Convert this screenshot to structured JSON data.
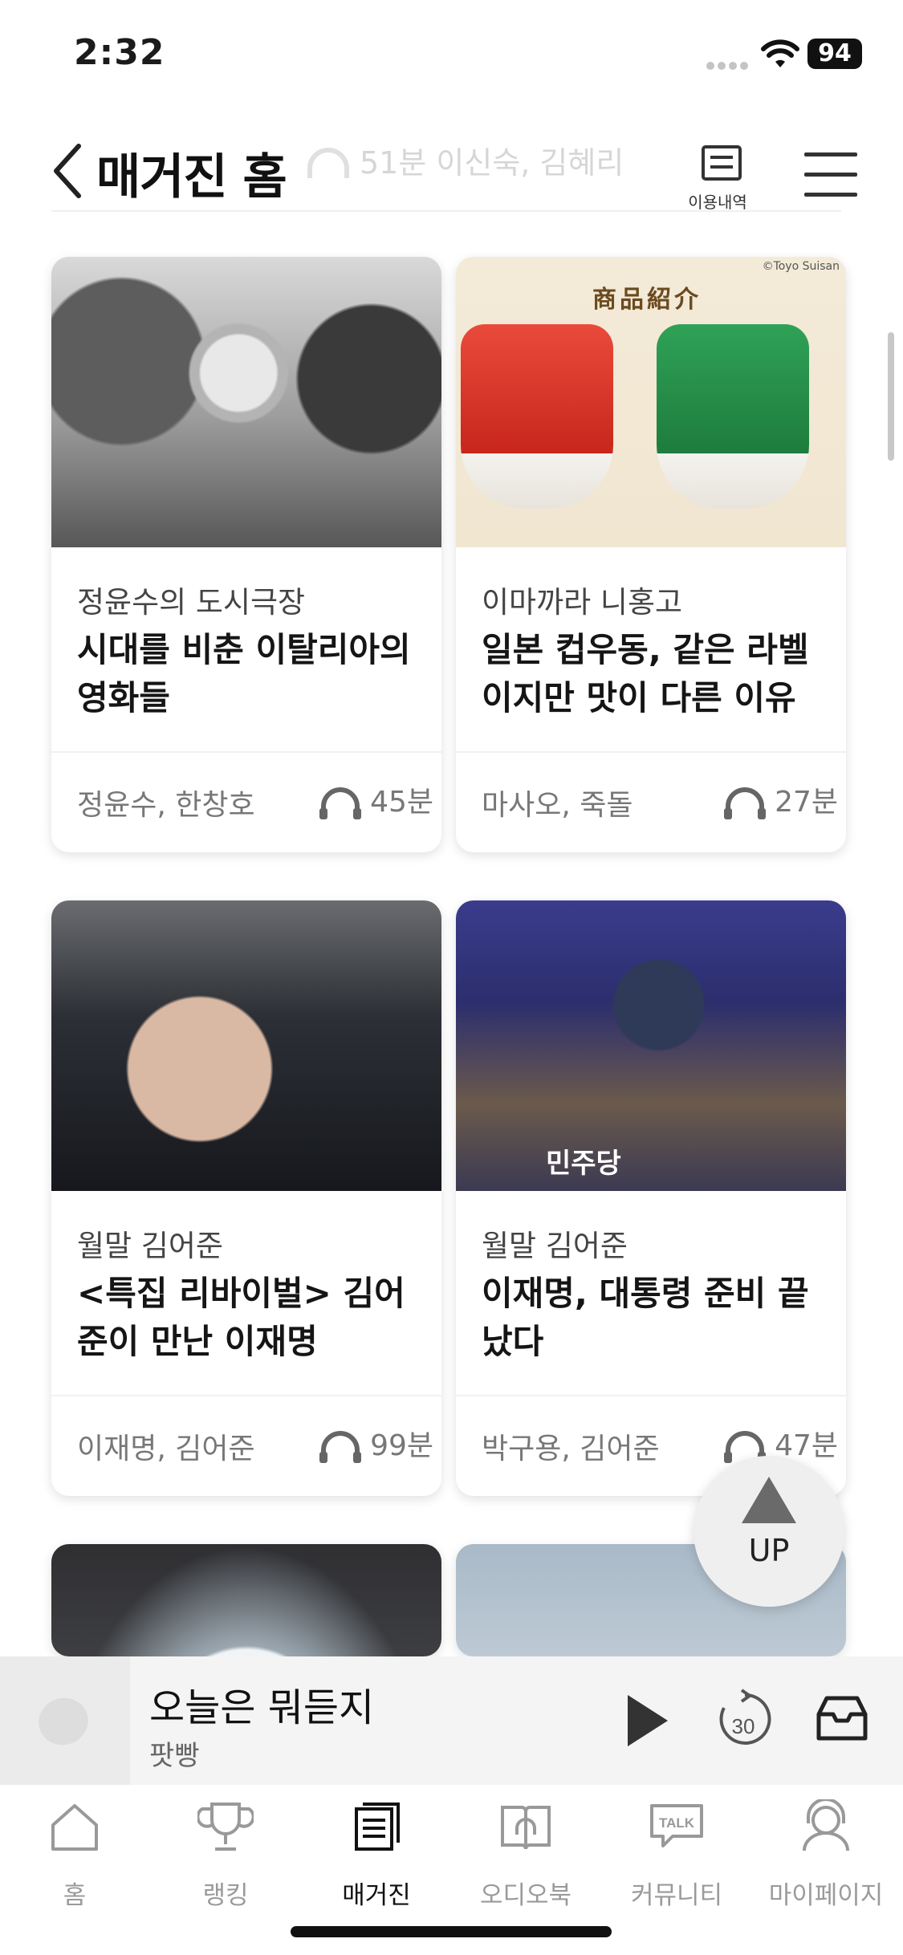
{
  "status_bar": {
    "time": "2:32",
    "battery": "94"
  },
  "header": {
    "back_label": "back",
    "title": "매거진 홈",
    "behind_text": "51분    이신숙, 김혜리",
    "history_label": "이용내역"
  },
  "cards": [
    {
      "series": "정윤수의 도시극장",
      "title": "시대를 비춘 이탈리아의 영화들",
      "people": "정윤수, 한창호",
      "duration": "45분"
    },
    {
      "series": "이마까라 니홍고",
      "title": "일본 컵우동, 같은 라벨 이지만 맛이 다른 이유",
      "people": "마사오, 죽돌",
      "duration": "27분",
      "image_heading": "商品紹介",
      "image_credit": "©Toyo Suisan"
    },
    {
      "series": "월말 김어준",
      "title": "<특집 리바이벌> 김어 준이 만난 이재명",
      "people": "이재명, 김어준",
      "duration": "99분"
    },
    {
      "series": "월말 김어준",
      "title": "이재명, 대통령 준비 끝 났다",
      "people": "박구용, 김어준",
      "duration": "47분",
      "image_tag": "민주당"
    }
  ],
  "up_button": {
    "label": "UP"
  },
  "player": {
    "title": "오늘은 뭐듣지",
    "subtitle": "팟빵",
    "skip_seconds": "30"
  },
  "tabs": [
    {
      "label": "홈",
      "icon": "home-icon"
    },
    {
      "label": "랭킹",
      "icon": "trophy-icon"
    },
    {
      "label": "매거진",
      "icon": "magazine-icon",
      "active": true
    },
    {
      "label": "오디오북",
      "icon": "audiobook-icon"
    },
    {
      "label": "커뮤니티",
      "icon": "talk-icon"
    },
    {
      "label": "마이페이지",
      "icon": "profile-icon"
    }
  ],
  "colors": {
    "accent_text": "#111111",
    "muted_text": "#777777",
    "player_bg": "#f4f4f4"
  }
}
